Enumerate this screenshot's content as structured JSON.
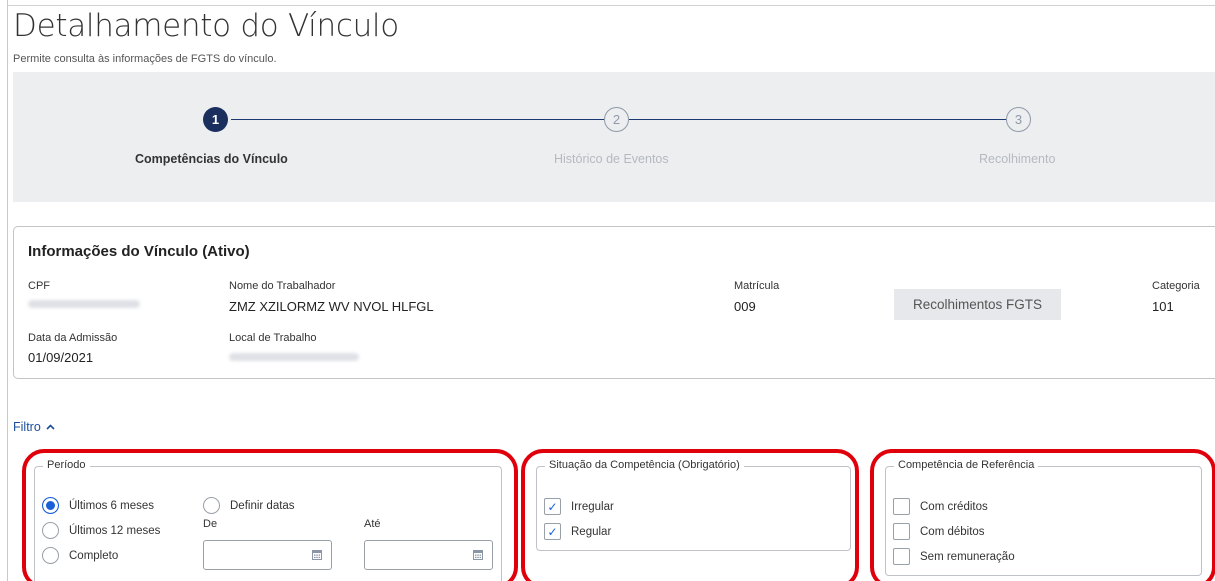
{
  "page": {
    "title": "Detalhamento do Vínculo",
    "subtitle": "Permite consulta às informações de FGTS do vínculo."
  },
  "stepper": {
    "steps": [
      {
        "number": "1",
        "label": "Competências do Vínculo",
        "state": "active"
      },
      {
        "number": "2",
        "label": "Histórico de Eventos",
        "state": "inactive"
      },
      {
        "number": "3",
        "label": "Recolhimento",
        "state": "inactive"
      }
    ]
  },
  "info": {
    "title": "Informações do Vínculo (Ativo)",
    "cpf_label": "CPF",
    "nome_label": "Nome do Trabalhador",
    "nome_value": "ZMZ XZILORMZ WV NVOL HLFGL",
    "matricula_label": "Matrícula",
    "matricula_value": "009",
    "categoria_label": "Categoria",
    "categoria_value": "101",
    "admissao_label": "Data da Admissão",
    "admissao_value": "01/09/2021",
    "local_label": "Local de Trabalho",
    "recolhimentos_button": "Recolhimentos FGTS"
  },
  "filter": {
    "toggle_label": "Filtro",
    "periodo": {
      "legend": "Período",
      "options": [
        "Últimos 6 meses",
        "Últimos 12 meses",
        "Completo",
        "Definir datas"
      ],
      "selected": "Últimos 6 meses",
      "de_label": "De",
      "ate_label": "Até"
    },
    "situacao": {
      "legend": "Situação da Competência (Obrigatório)",
      "options": [
        {
          "label": "Irregular",
          "checked": true
        },
        {
          "label": "Regular",
          "checked": true
        }
      ]
    },
    "referencia": {
      "legend": "Competência de Referência",
      "options": [
        {
          "label": "Com créditos",
          "checked": false
        },
        {
          "label": "Com débitos",
          "checked": false
        },
        {
          "label": "Sem remuneração",
          "checked": false
        }
      ]
    }
  },
  "colors": {
    "primary": "#1b2f5e",
    "link": "#1b4e9b",
    "checkbox": "#1a5fd6",
    "highlight_ring": "#e0000b",
    "stepper_bg": "#eceef0"
  }
}
